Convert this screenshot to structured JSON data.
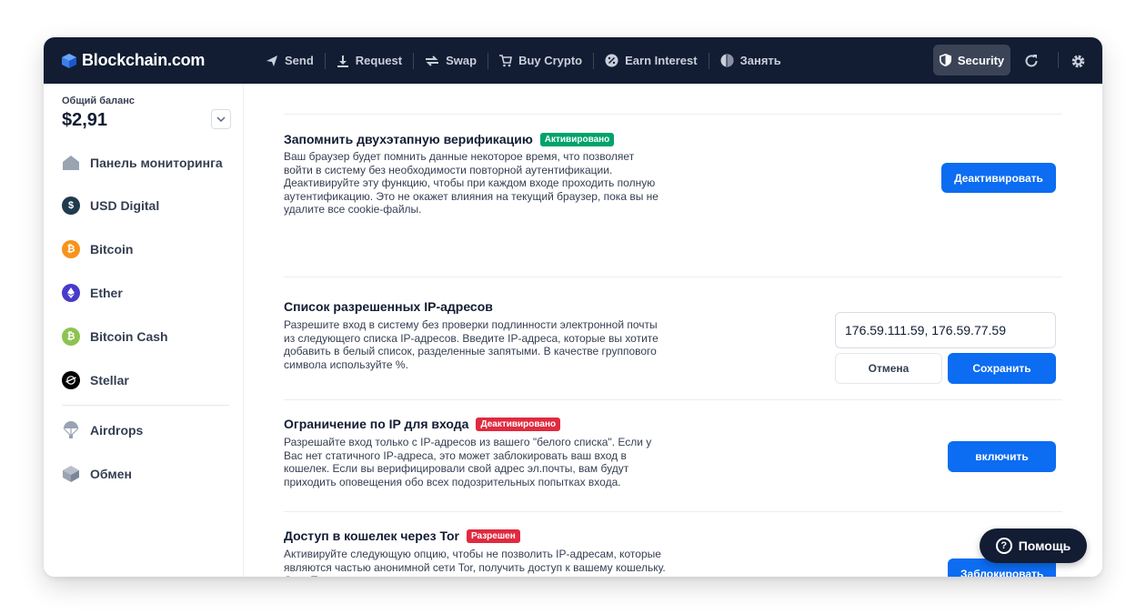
{
  "app": {
    "logo_text": "Blockchain.com"
  },
  "nav": [
    {
      "label": "Send",
      "icon": "send-icon"
    },
    {
      "label": "Request",
      "icon": "download-icon"
    },
    {
      "label": "Swap",
      "icon": "swap-icon"
    },
    {
      "label": "Buy Crypto",
      "icon": "cart-icon"
    },
    {
      "label": "Earn Interest",
      "icon": "percent-icon"
    },
    {
      "label": "Занять",
      "icon": "borrow-icon"
    }
  ],
  "header": {
    "security_label": "Security"
  },
  "sidebar": {
    "balance_label": "Общий баланс",
    "balance_value": "$2,91",
    "items": [
      {
        "label": "Панель мониторинга",
        "icon": "home-icon"
      },
      {
        "label": "USD Digital",
        "icon": "usd-digital-icon",
        "color": "#1f3b4d"
      },
      {
        "label": "Bitcoin",
        "icon": "bitcoin-icon",
        "color": "#f7931a"
      },
      {
        "label": "Ether",
        "icon": "ether-icon",
        "color": "#473bcb"
      },
      {
        "label": "Bitcoin Cash",
        "icon": "bitcoin-cash-icon",
        "color": "#8dc351"
      },
      {
        "label": "Stellar",
        "icon": "stellar-icon",
        "color": "#000000"
      },
      {
        "label": "Airdrops",
        "icon": "parachute-icon"
      },
      {
        "label": "Обмен",
        "icon": "exchange-icon"
      }
    ]
  },
  "sections": {
    "remember2fa": {
      "title": "Запомнить двухэтапную верификацию",
      "badge": "Активировано",
      "description": "Ваш браузер будет помнить данные некоторое время, что позволяет войти в систему без необходимости повторной аутентификации. Деактивируйте эту функцию, чтобы при каждом входе проходить полную аутентификацию. Это не окажет влияния на текущий браузер, пока вы не удалите все cookie-файлы.",
      "button": "Деактивировать"
    },
    "ip_whitelist": {
      "title": "Список разрешенных IP-адресов",
      "description": "Разрешите вход в систему без проверки подлинности электронной почты из следующего списка IP-адресов. Введите IP-адреса, которые вы хотите добавить в белый список, разделенные запятыми. В качестве группового символа используйте %.",
      "input_value": "176.59.111.59, 176.59.77.59",
      "cancel": "Отмена",
      "save": "Сохранить"
    },
    "ip_restrict": {
      "title": "Ограничение по IP для входа",
      "badge": "Деактивировано",
      "description": "Разрешайте вход только с IP-адресов из вашего \"белого списка\". Если у Вас нет статичного IP-адреса, это может заблокировать ваш вход в кошелек. Если вы верифицировали свой адрес эл.почты, вам будут приходить оповещения обо всех подозрительных попытках входа.",
      "button": "включить"
    },
    "tor": {
      "title": "Доступ в кошелек через Tor",
      "badge": "Разрешен",
      "description": "Активируйте следующую опцию, чтобы не позволить IP-адресам, которые являются частью анонимной сети Tor, получить доступ к вашему кошельку. Сеть Tor часто используется хакерами, пытающимися получить доступ к кошелькам пользователей",
      "button": "Заблокировать"
    }
  },
  "help": {
    "label": "Помощь"
  },
  "colors": {
    "topbar": "#121d33",
    "accent": "#0c6cf2",
    "green": "#00a36c",
    "red": "#e02a3f"
  }
}
